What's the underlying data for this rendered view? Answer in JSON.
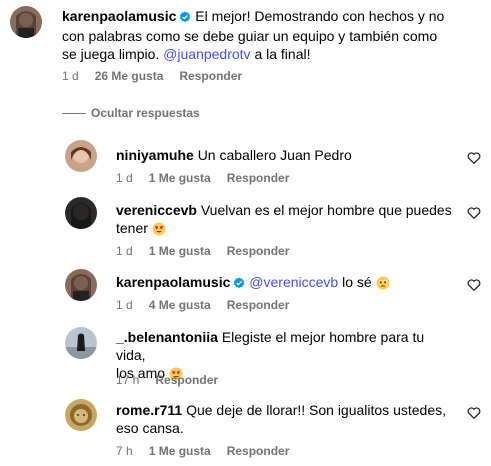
{
  "comments": [
    {
      "username": "karenpaolamusic",
      "verified": true,
      "text_line1": "El mejor! Demostrando con hechos y no",
      "text_line2": "con palabras como se debe guiar un equipo y también como",
      "text_line3_pre": "se juega limpio. ",
      "mention": "@juanpedrotv",
      "text_line3_post": " a la final!",
      "time": "1 d",
      "likes": "26 Me gusta",
      "reply": "Responder"
    }
  ],
  "hide_replies": "Ocultar respuestas",
  "replies": [
    {
      "username": "niniyamuhe",
      "text": "Un caballero Juan Pedro",
      "time": "1 d",
      "likes": "1 Me gusta",
      "reply": "Responder"
    },
    {
      "username": "vereniccevb",
      "text_line1": "Vuelvan es el mejor hombre que puedes",
      "text_line2": "tener",
      "emoji": "heart-eyes",
      "time": "1 d",
      "likes": "1 Me gusta",
      "reply": "Responder"
    },
    {
      "username": "karenpaolamusic",
      "verified": true,
      "mention": "@vereniccevb",
      "text": " lo sé",
      "emoji": "pleading-face",
      "time": "1 d",
      "likes": "4 Me gusta",
      "reply": "Responder"
    },
    {
      "username": "_.belenantoniia",
      "text_line1": "Elegiste el mejor hombre para tu vida,",
      "text_line2": "los amo",
      "emoji": "heart-eyes",
      "time": "17 h",
      "reply": "Responder"
    },
    {
      "username": "rome.r711",
      "text_line1": "Que deje de llorar!! Son igualitos ustedes,",
      "text_line2": "eso cansa.",
      "time": "7 h",
      "likes": "1 Me gusta",
      "reply": "Responder"
    }
  ],
  "colors": {
    "mention": "#4150F7",
    "meta": "#737373",
    "verified": "#0095F6"
  },
  "icons": [
    "verified-badge-icon",
    "heart-icon",
    "heart-eyes-emoji",
    "pleading-face-emoji"
  ]
}
